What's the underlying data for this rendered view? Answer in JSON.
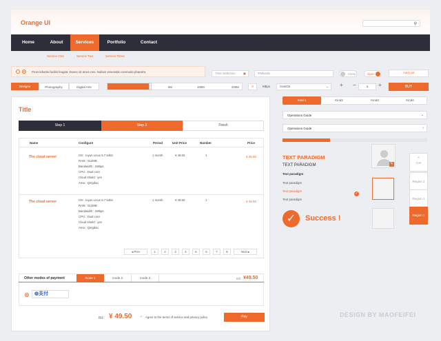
{
  "brand": "Orange UI",
  "nav": [
    "Home",
    "About",
    "Services",
    "Portfolio",
    "Contact"
  ],
  "subnav": [
    "Service One",
    "Service Two",
    "Service Three"
  ],
  "notice": "Proin lobortis facilisi feugiat. Donec sit amet cres. Nullam venenatis commodo pharetra.",
  "time_selection": "Time Selection",
  "keywords": "#Wkords",
  "close": "Close",
  "open": "Open",
  "add_list": "Add List",
  "filters": [
    "Designs",
    "Photography",
    "Digital Arts"
  ],
  "bw": [
    "5M",
    "100M",
    "200M"
  ],
  "bw_val": "0",
  "bw_unit": "Mbps",
  "os": "CentOs",
  "qty": "1",
  "buy": "BUY",
  "title": "Title",
  "steps": [
    "Step 1",
    "Step 2",
    "Finish"
  ],
  "cols": [
    "Name",
    "Configure",
    "Period",
    "Unit Price",
    "Number",
    "Price"
  ],
  "orders": [
    {
      "name": "The cloud server",
      "cfg": [
        "OS : ruyun Linux 5.7 64bit",
        "RAM : 512MB",
        "Bandwidth : 1Mbps",
        "CPU : Dual core",
        "Cloud shield : yes",
        "Area : Qingdao"
      ],
      "period": "1 month",
      "unit": "¥ 49.50",
      "num": "1",
      "price": "¥ 49.50"
    },
    {
      "name": "The cloud server",
      "cfg": [
        "OS : ruyun Linux 5.7 64bit",
        "RAM : 512MB",
        "Bandwidth : 1Mbps",
        "CPU : Dual core",
        "Cloud shield : yes",
        "Area : Qingdao"
      ],
      "period": "1 month",
      "unit": "¥ 49.50",
      "num": "1",
      "price": "¥ 49.50"
    }
  ],
  "prev": "Prev",
  "pages": [
    "1",
    "2",
    "3",
    "4",
    "5",
    "6",
    "7",
    "8"
  ],
  "next": "Next",
  "payment_label": "Other modes of payment",
  "modes": [
    "mode 1",
    "mode 2",
    "mode 3"
  ],
  "bill_small": "Bill :",
  "bill_small_val": "¥49.50",
  "bill": "Bill :",
  "bill_val": "¥ 49.50",
  "agree": "Agree to the terms of service and privacy policy",
  "pay": "Pay",
  "kinds": [
    "Kind 1",
    "Kind2",
    "Kind3",
    "Kind4"
  ],
  "guides": [
    "Operations Guide",
    "Operations Guide"
  ],
  "para_title": "TEXT PARADIGM",
  "para_sub": "TEXT PARADIGM",
  "para_items": [
    "Text paradigm",
    "Text paradigm",
    "Text paradigm",
    "Text paradigm"
  ],
  "success": "Success !",
  "top": "TOP",
  "regions": [
    "Region 1",
    "Region 1",
    "Region 1"
  ],
  "footer": "DESIGN BY MAOFEIFEI",
  "progress": 0.33
}
